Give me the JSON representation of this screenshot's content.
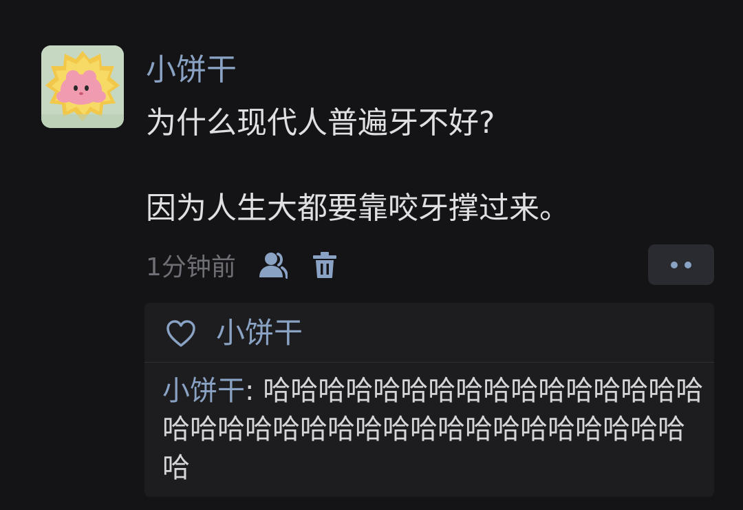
{
  "post": {
    "username": "小饼干",
    "content_line1": "为什么现代人普遍牙不好?",
    "content_line2": "因为人生大都要靠咬牙撑过来。",
    "time": "1分钟前",
    "icons": {
      "visibility": "friends-visibility-icon",
      "delete": "trash-icon",
      "more": "more-dots-icon"
    }
  },
  "likes": {
    "icon": "heart-outline-icon",
    "names": "小饼干"
  },
  "comments": [
    {
      "author": "小饼干",
      "separator": ": ",
      "text": "哈哈哈哈哈哈哈哈哈哈哈哈哈哈哈哈哈哈哈哈哈哈哈哈哈哈哈哈哈哈哈哈哈哈哈哈"
    }
  ],
  "colors": {
    "background": "#141416",
    "name_blue": "#8aa3c4",
    "text": "#e0e0e2",
    "muted": "#6e6f75",
    "panel": "#1d1d20"
  }
}
